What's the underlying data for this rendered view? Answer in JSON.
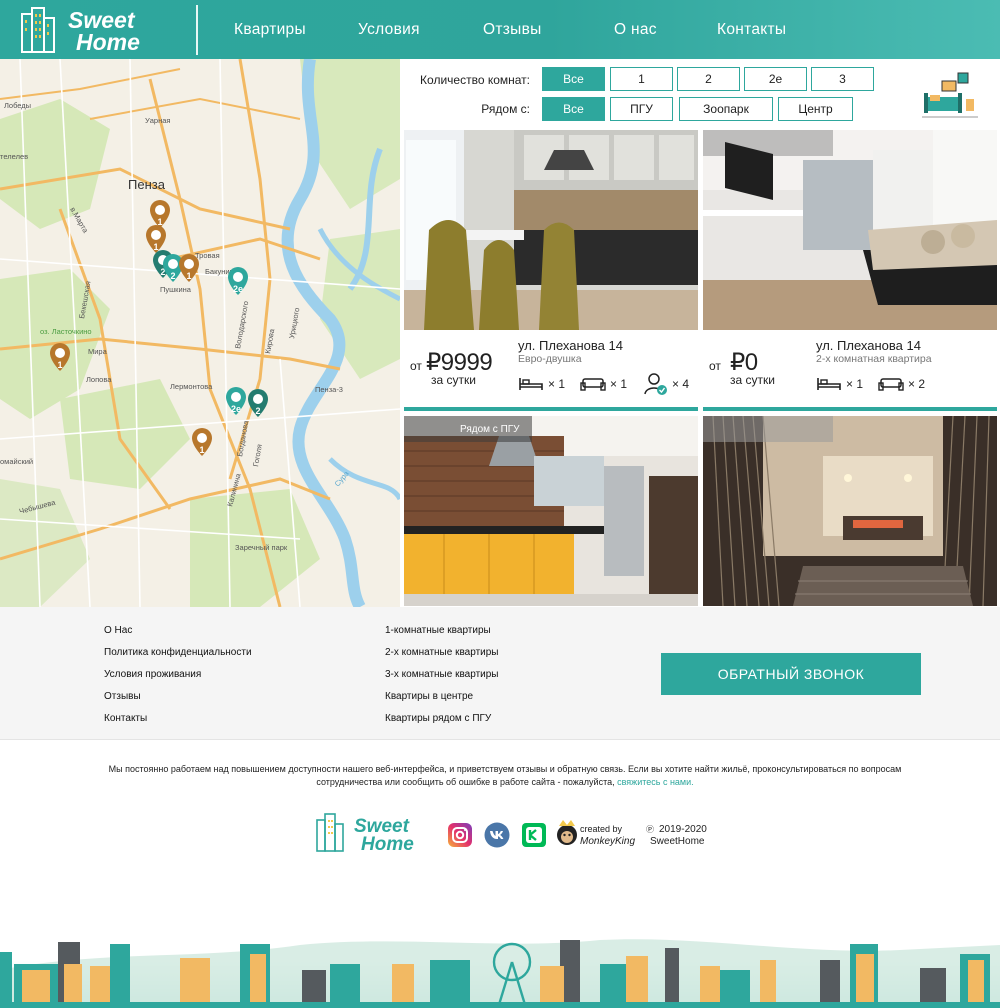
{
  "brand": {
    "logo_line1": "Sweet",
    "logo_line2": "Home"
  },
  "nav": [
    "Квартиры",
    "Условия",
    "Отзывы",
    "О нас",
    "Контакты"
  ],
  "map": {
    "city_label": "Пенза",
    "streets": [
      "Лобеды",
      "Уарная",
      "телелев",
      "в.Марта",
      "Бекешская",
      "Пушкина",
      "Бакунина",
      "Володарского",
      "Урицкого",
      "Кирова",
      "Мира",
      "Лопова",
      "Лермонтова",
      "Богданова",
      "Калинина",
      "Гоголя",
      "Пенза-3",
      "Заречный парк",
      "Чебышева",
      "омайский",
      "оз. Ласточкино",
      "Сура",
      "Тровая"
    ],
    "pins": [
      {
        "label": "1",
        "kind": "brown"
      },
      {
        "label": "1",
        "kind": "brown"
      },
      {
        "label": "2",
        "kind": "teal"
      },
      {
        "label": "2",
        "kind": "teal"
      },
      {
        "label": "1",
        "kind": "brown"
      },
      {
        "label": "2е",
        "kind": "teal"
      },
      {
        "label": "1",
        "kind": "brown"
      },
      {
        "label": "2е",
        "kind": "teal"
      },
      {
        "label": "2",
        "kind": "teal"
      },
      {
        "label": "1",
        "kind": "brown"
      }
    ]
  },
  "filters": {
    "rooms_label": "Количество комнат:",
    "rooms": [
      "Все",
      "1",
      "2",
      "2е",
      "3"
    ],
    "near_label": "Рядом с:",
    "near": [
      "Все",
      "ПГУ",
      "Зоопарк",
      "Центр"
    ]
  },
  "cards": [
    {
      "price_from": "от",
      "price": "₽9999",
      "per": "за сутки",
      "address": "ул. Плеханова 14",
      "type": "Евро-двушка",
      "beds": "× 1",
      "sofas": "× 1",
      "guests": "× 4"
    },
    {
      "price_from": "от",
      "price": "₽0",
      "per": "за сутки",
      "address": "ул. Плеханова 14",
      "type": "2-х комнатная квартира",
      "beds": "× 1",
      "sofas": "× 2"
    },
    {
      "tag": "Рядом с ПГУ"
    },
    {
      "tag": ""
    }
  ],
  "footer": {
    "col1": [
      "О Нас",
      "Политика конфиденциальности",
      "Условия проживания",
      "Отзывы",
      "Контакты"
    ],
    "col2": [
      "1-комнатные квартиры",
      "2-х комнатные квартиры",
      "3-х комнатные квартиры",
      "Квартиры в центре",
      "Квартиры рядом с ПГУ"
    ],
    "callback": "Обратный звонок",
    "notice": "Мы постоянно работаем над повышением доступности нашего веб-интерфейса, и приветствуем отзывы и обратную связь. Если вы хотите найти жильё, проконсультироваться по вопросам сотрудничества или сообщить об ошибке в работе сайта - пожалуйста, ",
    "notice_link": "свяжитесь с нами.",
    "created_by": "created by",
    "creator": "MonkeyKing",
    "copyright_mark": "Ⓟ",
    "copyright_years": "2019-2020",
    "copyright_name": "SweetHome"
  },
  "colors": {
    "teal": "#2ea79d",
    "brown": "#b7772c",
    "yellow": "#f2b963"
  }
}
